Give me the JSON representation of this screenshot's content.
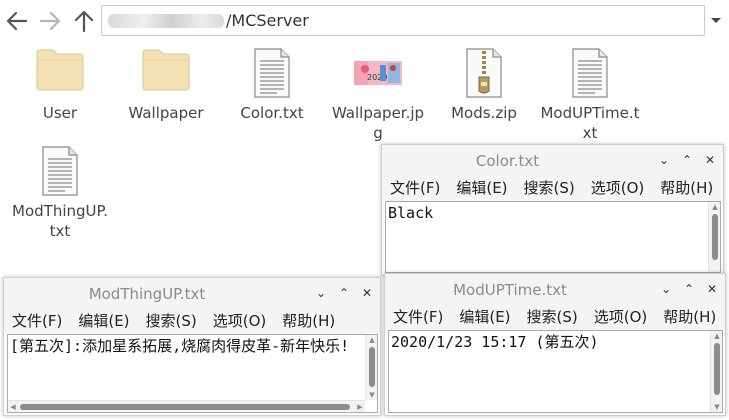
{
  "address": {
    "path": "/MCServer"
  },
  "files": [
    {
      "name": "User",
      "icon": "folder-icon"
    },
    {
      "name": "Wallpaper",
      "icon": "folder-icon"
    },
    {
      "name": "Color.txt",
      "icon": "text-file-icon"
    },
    {
      "name": "Wallpaper.jpg",
      "icon": "image-file-icon"
    },
    {
      "name": "Mods.zip",
      "icon": "zip-file-icon"
    },
    {
      "name": "ModUPTime.txt",
      "icon": "text-file-icon"
    },
    {
      "name": "ModThingUP.txt",
      "icon": "text-file-icon"
    }
  ],
  "windows": {
    "color": {
      "title": "Color.txt",
      "content": "Black",
      "menu": [
        "文件(F)",
        "编辑(E)",
        "搜索(S)",
        "选项(O)",
        "帮助(H)"
      ]
    },
    "modthing": {
      "title": "ModThingUP.txt",
      "content": "[第五次]:添加星系拓展,烧腐肉得皮革-新年快乐!",
      "menu": [
        "文件(F)",
        "编辑(E)",
        "搜索(S)",
        "选项(O)",
        "帮助(H)"
      ]
    },
    "modtime": {
      "title": "ModUPTime.txt",
      "content": "2020/1/23 15:17 (第五次)",
      "menu": [
        "文件(F)",
        "编辑(E)",
        "搜索(S)",
        "选项(O)",
        "帮助(H)"
      ]
    }
  },
  "window_controls": {
    "minimize": "⌄",
    "maximize": "⌃",
    "close": "✕"
  },
  "colors": {
    "folder": "#f1deb0",
    "titlebar": "#f4f4f4",
    "scroll_thumb": "#8c8c8c"
  }
}
